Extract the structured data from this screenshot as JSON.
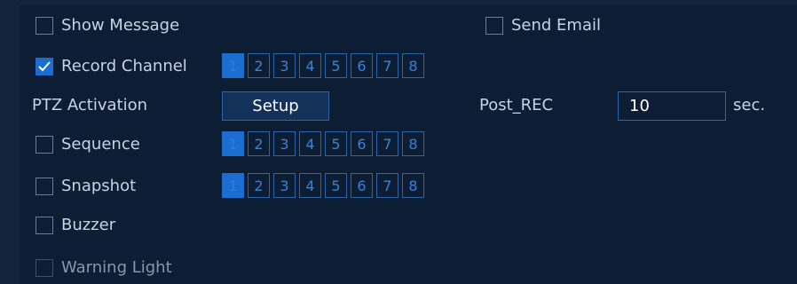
{
  "rows": {
    "show_message": {
      "label": "Show Message",
      "checked": false
    },
    "send_email": {
      "label": "Send Email",
      "checked": false
    },
    "record_channel": {
      "label": "Record Channel",
      "checked": true,
      "channels": [
        "1",
        "2",
        "3",
        "4",
        "5",
        "6",
        "7",
        "8"
      ],
      "selected": [
        "1"
      ]
    },
    "ptz_activation": {
      "label": "PTZ Activation",
      "button_label": "Setup"
    },
    "post_rec": {
      "label": "Post_REC",
      "value": "10",
      "unit": "sec."
    },
    "sequence": {
      "label": "Sequence",
      "checked": false,
      "channels": [
        "1",
        "2",
        "3",
        "4",
        "5",
        "6",
        "7",
        "8"
      ],
      "selected": [
        "1"
      ]
    },
    "snapshot": {
      "label": "Snapshot",
      "checked": false,
      "channels": [
        "1",
        "2",
        "3",
        "4",
        "5",
        "6",
        "7",
        "8"
      ],
      "selected": [
        "1"
      ]
    },
    "buzzer": {
      "label": "Buzzer",
      "checked": false
    },
    "warning_light": {
      "label": "Warning Light",
      "checked": false,
      "disabled": true
    }
  },
  "colors": {
    "background": "#0d1d33",
    "accent": "#1c6dd0",
    "border": "#2e64a8",
    "text": "#c9d3e0"
  }
}
